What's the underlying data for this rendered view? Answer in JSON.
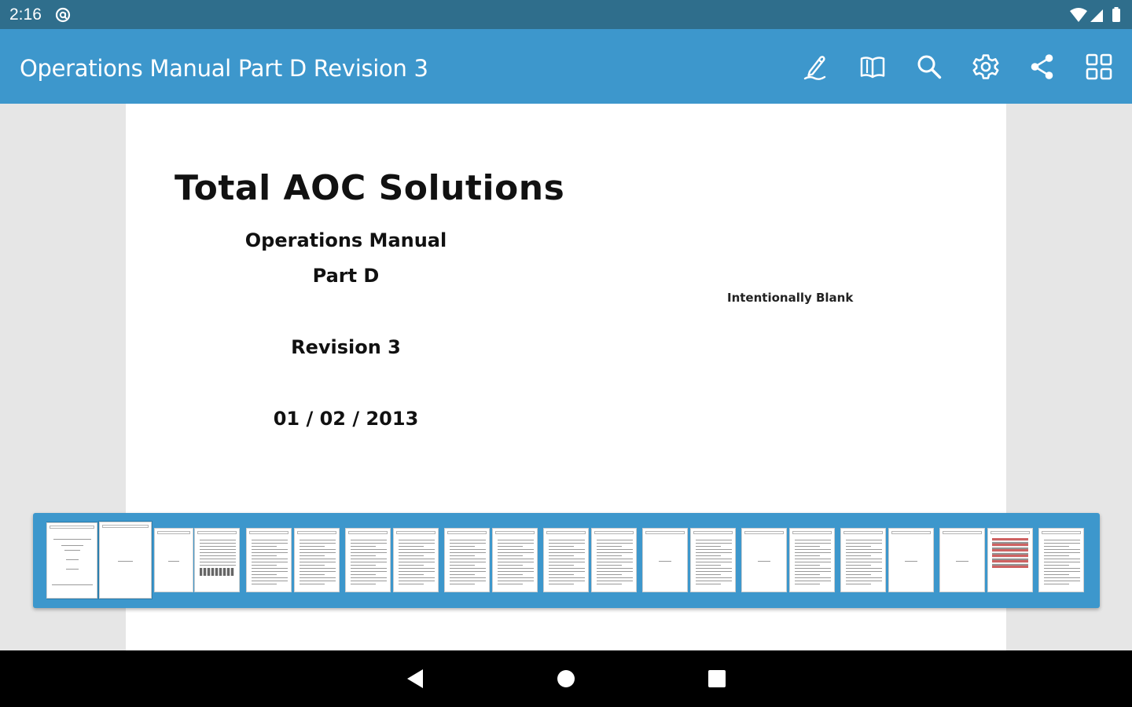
{
  "status_bar": {
    "time": "2:16",
    "icons": [
      "notification-icon",
      "wifi-icon",
      "signal-icon",
      "battery-icon"
    ]
  },
  "app_bar": {
    "title": "Operations Manual Part D Revision 3",
    "actions": [
      {
        "name": "annotate",
        "icon": "pen-icon"
      },
      {
        "name": "reading-mode",
        "icon": "book-icon"
      },
      {
        "name": "search",
        "icon": "search-icon"
      },
      {
        "name": "settings",
        "icon": "gear-icon"
      },
      {
        "name": "share",
        "icon": "share-icon"
      },
      {
        "name": "grid-view",
        "icon": "grid-icon"
      }
    ]
  },
  "document": {
    "title": "Total AOC Solutions",
    "subtitle": "Operations Manual",
    "part": "Part D",
    "revision": "Revision 3",
    "date": "01 / 02 / 2013",
    "facing_page_note": "Intentionally Blank"
  },
  "thumbnails": {
    "selected_pages": [
      1,
      2
    ]
  },
  "nav_bar": {
    "buttons": [
      "back",
      "home",
      "recents"
    ]
  },
  "colors": {
    "status_bar": "#2f6e8c",
    "app_bar": "#3d97cc",
    "background": "#e6e6e6",
    "nav_bar": "#000000"
  }
}
